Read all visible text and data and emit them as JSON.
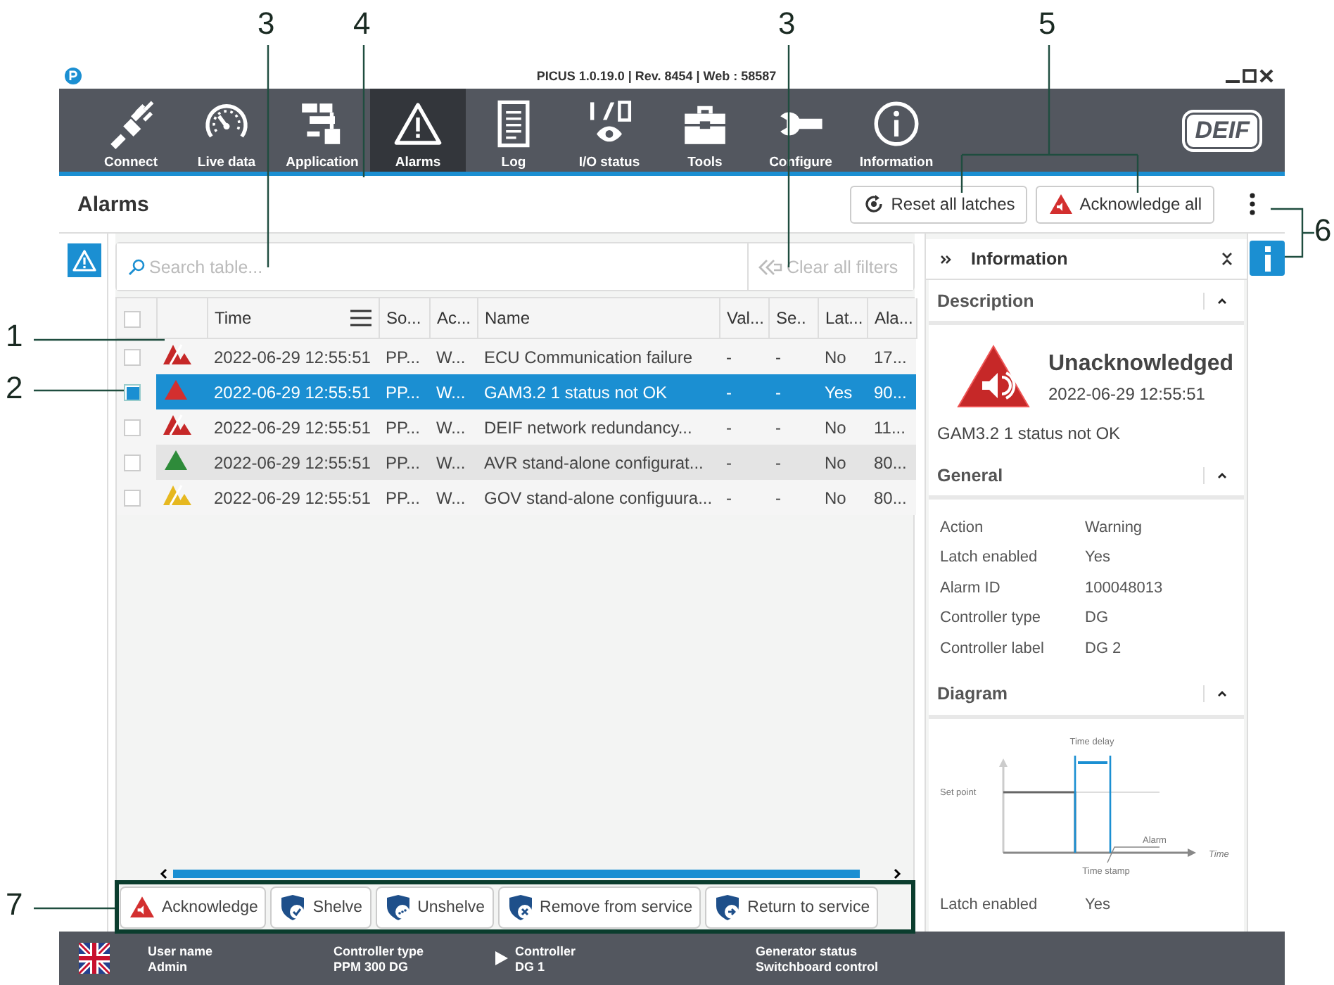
{
  "callouts": [
    {
      "label": "3"
    },
    {
      "label": "4"
    },
    {
      "label": "3"
    },
    {
      "label": "5"
    },
    {
      "label": "6"
    },
    {
      "label": "1"
    },
    {
      "label": "2"
    },
    {
      "label": "7"
    }
  ],
  "window": {
    "title": "PICUS 1.0.19.0 | Rev. 8454 | Web : 58587"
  },
  "nav": [
    {
      "label": "Connect",
      "kind": "plug",
      "selected": false
    },
    {
      "label": "Live data",
      "kind": "gauge",
      "selected": false
    },
    {
      "label": "Application",
      "kind": "app",
      "selected": false
    },
    {
      "label": "Alarms",
      "kind": "alarm",
      "selected": true
    },
    {
      "label": "Log",
      "kind": "log",
      "selected": false
    },
    {
      "label": "I/O status",
      "kind": "io",
      "selected": false
    },
    {
      "label": "Tools",
      "kind": "tools",
      "selected": false
    },
    {
      "label": "Configure",
      "kind": "wrench",
      "selected": false
    },
    {
      "label": "Information",
      "kind": "info",
      "selected": false
    }
  ],
  "logo": "DEIF",
  "page": {
    "title": "Alarms",
    "buttons": [
      {
        "label": "Reset all latches",
        "kind": "reset"
      },
      {
        "label": "Acknowledge all",
        "kind": "ack"
      }
    ]
  },
  "search": {
    "placeholder": "Search table...",
    "clear": "Clear all filters"
  },
  "table": {
    "all_checked": false,
    "columns": [
      "Time",
      "So...",
      "Ac...",
      "Name",
      "Val...",
      "Se..",
      "Lat...",
      "Ala..."
    ],
    "rows": [
      {
        "checked": false,
        "selected": false,
        "highlighted": false,
        "kind": "crossed",
        "color": "#c62828",
        "cells": [
          "2022-06-29 12:55:51",
          "PP...",
          "W...",
          "ECU Communication failure",
          "-",
          "-",
          "No",
          "17..."
        ]
      },
      {
        "checked": true,
        "selected": true,
        "highlighted": false,
        "kind": "solid",
        "color": "#d32f2f",
        "cells": [
          "2022-06-29 12:55:51",
          "PP...",
          "W...",
          "GAM3.2 1 status not OK",
          "-",
          "-",
          "Yes",
          "90..."
        ]
      },
      {
        "checked": false,
        "selected": false,
        "highlighted": false,
        "kind": "crossed",
        "color": "#c62828",
        "cells": [
          "2022-06-29 12:55:51",
          "PP...",
          "W...",
          "DEIF network redundancy...",
          "-",
          "-",
          "No",
          "11..."
        ]
      },
      {
        "checked": false,
        "selected": false,
        "highlighted": true,
        "kind": "solid",
        "color": "#2e8b3a",
        "cells": [
          "2022-06-29 12:55:51",
          "PP...",
          "W...",
          "AVR stand-alone configurat...",
          "-",
          "-",
          "No",
          "80..."
        ]
      },
      {
        "checked": false,
        "selected": false,
        "highlighted": false,
        "kind": "crossed",
        "color": "#e6b820",
        "cells": [
          "2022-06-29 12:55:51",
          "PP...",
          "W...",
          "GOV stand-alone configuura...",
          "-",
          "-",
          "No",
          "80..."
        ]
      }
    ]
  },
  "actions": [
    {
      "label": "Acknowledge",
      "kind": "ack"
    },
    {
      "label": "Shelve",
      "kind": "shelve"
    },
    {
      "label": "Unshelve",
      "kind": "unshelve"
    },
    {
      "label": "Remove from service",
      "kind": "remove"
    },
    {
      "label": "Return to service",
      "kind": "return"
    }
  ],
  "info": {
    "title": "Information",
    "description": {
      "title": "Description",
      "expanded": true,
      "status": "Unacknowledged",
      "time": "2022-06-29 12:55:51",
      "text": "GAM3.2 1 status not OK"
    },
    "general": {
      "title": "General",
      "expanded": true,
      "rows": [
        {
          "label": "Action",
          "value": "Warning"
        },
        {
          "label": "Latch enabled",
          "value": "Yes"
        },
        {
          "label": "Alarm ID",
          "value": "100048013"
        },
        {
          "label": "Controller type",
          "value": "DG"
        },
        {
          "label": "Controller label",
          "value": "DG 2"
        }
      ]
    },
    "diagram": {
      "title": "Diagram",
      "expanded": true,
      "labels": [
        "Time delay",
        "Set point",
        "Alarm",
        "Time",
        "Time stamp"
      ],
      "rows": [
        {
          "label": "Latch enabled",
          "value": "Yes"
        }
      ]
    }
  },
  "status_bar": [
    {
      "label": "User name",
      "value": "Admin",
      "selected": false
    },
    {
      "label": "Controller type",
      "value": "PPM 300 DG",
      "selected": false
    },
    {
      "label": "Controller",
      "value": "DG 1",
      "selected": true
    },
    {
      "label": "Generator status",
      "value": "Switchboard control",
      "selected": false
    }
  ]
}
